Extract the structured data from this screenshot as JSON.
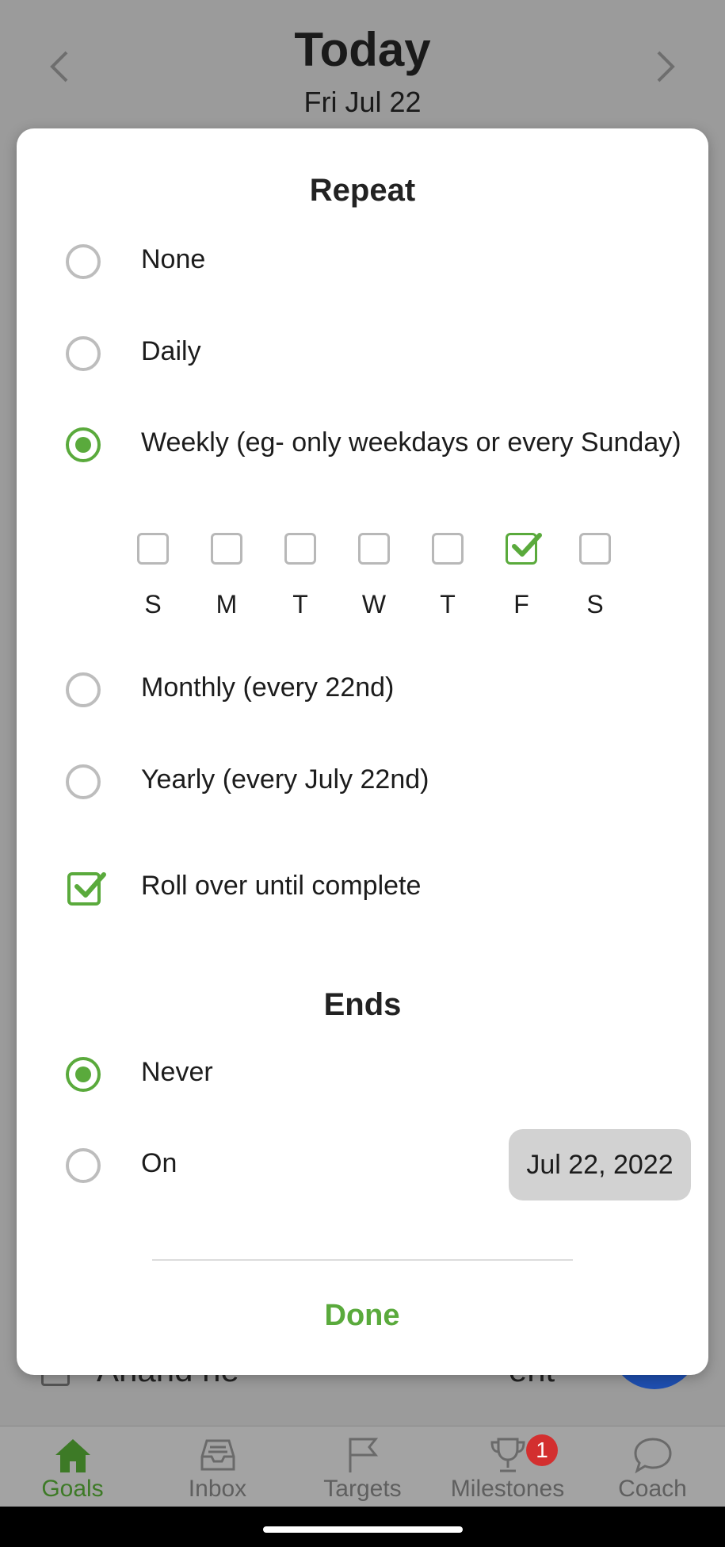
{
  "header": {
    "title": "Today",
    "date": "Fri Jul 22"
  },
  "background_task": {
    "text": "Anand ne",
    "text_tail": "ent"
  },
  "dialog": {
    "repeat_title": "Repeat",
    "options": [
      {
        "label": "None",
        "checked": false
      },
      {
        "label": "Daily",
        "checked": false
      },
      {
        "label": "Weekly (eg- only weekdays or every Sunday)",
        "checked": true
      },
      {
        "label": "Monthly (every 22nd)",
        "checked": false
      },
      {
        "label": "Yearly (every July 22nd)",
        "checked": false
      }
    ],
    "weekdays": [
      {
        "label": "S",
        "checked": false
      },
      {
        "label": "M",
        "checked": false
      },
      {
        "label": "T",
        "checked": false
      },
      {
        "label": "W",
        "checked": false
      },
      {
        "label": "T",
        "checked": false
      },
      {
        "label": "F",
        "checked": true
      },
      {
        "label": "S",
        "checked": false
      }
    ],
    "rollover": {
      "label": "Roll over until complete",
      "checked": true
    },
    "ends_title": "Ends",
    "ends_options": [
      {
        "label": "Never",
        "checked": true
      },
      {
        "label": "On",
        "checked": false
      }
    ],
    "end_date": "Jul 22, 2022",
    "done_label": "Done"
  },
  "bottom_nav": [
    {
      "label": "Goals",
      "icon": "home-icon",
      "active": true
    },
    {
      "label": "Inbox",
      "icon": "inbox-icon",
      "active": false
    },
    {
      "label": "Targets",
      "icon": "flag-icon",
      "active": false
    },
    {
      "label": "Milestones",
      "icon": "trophy-icon",
      "active": false,
      "badge": "1"
    },
    {
      "label": "Coach",
      "icon": "chat-bubble-icon",
      "active": false
    }
  ],
  "colors": {
    "accent": "#5aaa3c",
    "badge": "#d32f2f",
    "fab": "#1e4fb0"
  }
}
